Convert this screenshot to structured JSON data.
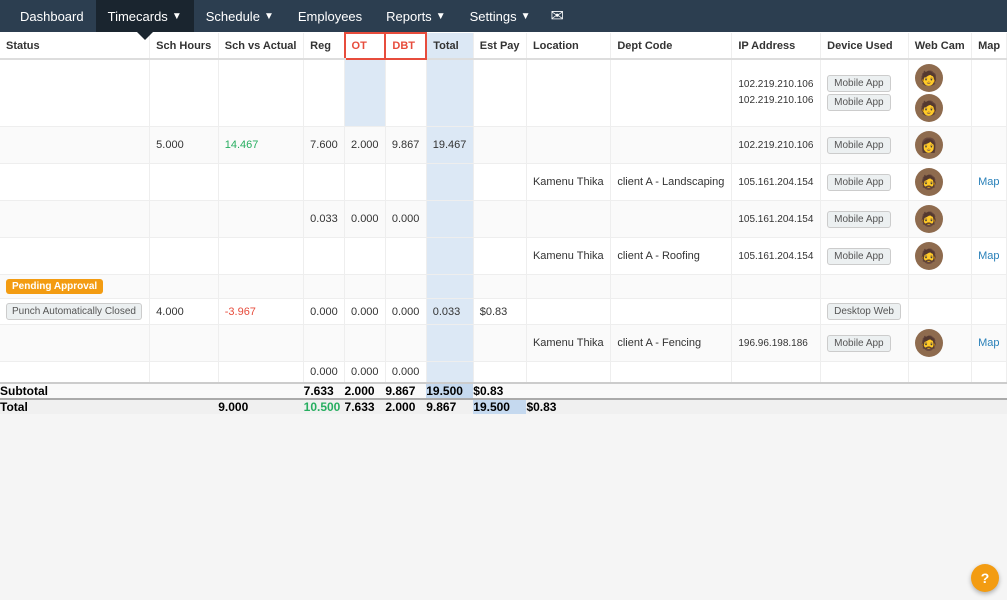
{
  "nav": {
    "items": [
      {
        "label": "Dashboard",
        "active": false
      },
      {
        "label": "Timecards",
        "active": true,
        "has_arrow": true
      },
      {
        "label": "Schedule",
        "active": false,
        "has_arrow": true
      },
      {
        "label": "Employees",
        "active": false
      },
      {
        "label": "Reports",
        "active": false,
        "has_arrow": true
      },
      {
        "label": "Settings",
        "active": false,
        "has_arrow": true
      }
    ],
    "mail_icon": "✉"
  },
  "table": {
    "headers": [
      {
        "label": "Status",
        "class": ""
      },
      {
        "label": "Sch Hours",
        "class": ""
      },
      {
        "label": "Sch vs Actual",
        "class": ""
      },
      {
        "label": "Reg",
        "class": ""
      },
      {
        "label": "OT",
        "class": "ot-header"
      },
      {
        "label": "DBT",
        "class": "dbt-header"
      },
      {
        "label": "Total",
        "class": "total-col"
      },
      {
        "label": "Est Pay",
        "class": ""
      },
      {
        "label": "Location",
        "class": ""
      },
      {
        "label": "Dept Code",
        "class": ""
      },
      {
        "label": "IP Address",
        "class": ""
      },
      {
        "label": "Device Used",
        "class": ""
      },
      {
        "label": "Web Cam",
        "class": ""
      },
      {
        "label": "Map",
        "class": ""
      }
    ],
    "rows": [
      {
        "status": "",
        "sch_hours": "",
        "sch_vs_actual": "",
        "reg": "",
        "ot": "",
        "dbt": "",
        "total": "",
        "est_pay": "",
        "location": "",
        "dept_code": "",
        "ip_address": "102.219.210.106\n102.219.210.106",
        "ip1": "102.219.210.106",
        "ip2": "102.219.210.106",
        "device": "Mobile App",
        "device2": "Mobile App",
        "has_two_devices": true,
        "webcam": true,
        "map": ""
      },
      {
        "status": "",
        "sch_hours": "5.000",
        "sch_vs_actual": "14.467",
        "reg": "7.600",
        "ot": "2.000",
        "dbt": "9.867",
        "total": "19.467",
        "est_pay": "",
        "location": "",
        "dept_code": "",
        "ip1": "102.219.210.106",
        "ip2": "",
        "device": "Mobile App",
        "device2": "",
        "has_two_devices": false,
        "webcam": true,
        "map": ""
      },
      {
        "status": "",
        "sch_hours": "",
        "sch_vs_actual": "",
        "reg": "",
        "ot": "",
        "dbt": "",
        "total": "",
        "est_pay": "",
        "location": "Kamenu Thika",
        "dept_code": "client A - Landscaping",
        "ip1": "105.161.204.154",
        "ip2": "",
        "device": "Mobile App",
        "device2": "",
        "has_two_devices": false,
        "webcam": true,
        "map": "Map"
      },
      {
        "status": "",
        "sch_hours": "",
        "sch_vs_actual": "",
        "reg": "0.033",
        "ot": "0.000",
        "dbt": "0.000",
        "total": "",
        "est_pay": "",
        "location": "",
        "dept_code": "",
        "ip1": "105.161.204.154",
        "ip2": "",
        "device": "Mobile App",
        "device2": "",
        "has_two_devices": false,
        "webcam": true,
        "map": ""
      },
      {
        "status": "",
        "sch_hours": "",
        "sch_vs_actual": "",
        "reg": "",
        "ot": "",
        "dbt": "",
        "total": "",
        "est_pay": "",
        "location": "Kamenu Thika",
        "dept_code": "client A - Roofing",
        "ip1": "105.161.204.154",
        "ip2": "",
        "device": "Mobile App",
        "device2": "",
        "has_two_devices": false,
        "webcam": true,
        "map": "Map"
      },
      {
        "status": "Pending Approval",
        "status_type": "pending",
        "sch_hours": "",
        "sch_vs_actual": "",
        "reg": "",
        "ot": "",
        "dbt": "",
        "total": "",
        "est_pay": "",
        "location": "",
        "dept_code": "",
        "ip1": "",
        "ip2": "",
        "device": "",
        "device2": "",
        "has_two_devices": false,
        "webcam": false,
        "map": ""
      },
      {
        "status": "Punch Automatically Closed",
        "status_type": "auto",
        "sch_hours": "4.000",
        "sch_vs_actual": "-3.967",
        "reg": "0.000",
        "ot": "0.000",
        "dbt": "0.000",
        "total": "0.033",
        "est_pay": "$0.83",
        "location": "",
        "dept_code": "",
        "ip1": "",
        "ip2": "",
        "device": "Desktop Web",
        "device2": "",
        "has_two_devices": false,
        "webcam": false,
        "map": ""
      },
      {
        "status": "",
        "sch_hours": "",
        "sch_vs_actual": "",
        "reg": "",
        "ot": "",
        "dbt": "",
        "total": "",
        "est_pay": "",
        "location": "Kamenu Thika",
        "dept_code": "client A - Fencing",
        "ip1": "196.96.198.186",
        "ip2": "",
        "device": "Mobile App",
        "device2": "",
        "has_two_devices": false,
        "webcam": true,
        "map": "Map"
      },
      {
        "status": "",
        "sch_hours": "",
        "sch_vs_actual": "",
        "reg": "0.000",
        "ot": "0.000",
        "dbt": "0.000",
        "total": "",
        "est_pay": "",
        "location": "",
        "dept_code": "",
        "ip1": "",
        "ip2": "",
        "device": "",
        "device2": "",
        "has_two_devices": false,
        "webcam": false,
        "map": ""
      }
    ],
    "subtotal": {
      "label": "Subtotal",
      "sch_hours": "",
      "sch_vs_actual": "",
      "reg": "7.633",
      "ot": "2.000",
      "dbt": "9.867",
      "total": "19.500",
      "est_pay": "$0.83"
    },
    "total": {
      "label": "Total",
      "sch_hours": "9.000",
      "sch_vs_actual": "10.500",
      "reg": "7.633",
      "ot": "2.000",
      "dbt": "9.867",
      "total": "19.500",
      "est_pay": "$0.83"
    }
  },
  "help_label": "?"
}
